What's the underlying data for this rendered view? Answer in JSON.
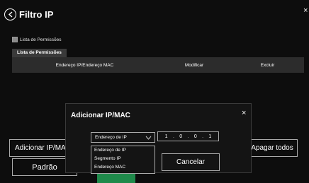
{
  "header": {
    "title": "Filtro IP",
    "close": "×"
  },
  "permissions": {
    "checkbox_label": "Lista de Permissões",
    "tab_label": "Lista de Permissões"
  },
  "table": {
    "columns": [
      "Endereço IP/Endereço MAC",
      "Modificar",
      "Excluir"
    ]
  },
  "buttons": {
    "add": "Adicionar IP/MAC",
    "delete_all": "Apagar todos",
    "default": "Padrão"
  },
  "modal": {
    "title": "Adicionar IP/MAC",
    "close": "×",
    "type_selected": "Endereço de IP",
    "type_options": [
      "Endereço de IP",
      "Segmento IP",
      "Endereço MAC"
    ],
    "ip_octets": [
      "1",
      "0",
      "0",
      "1"
    ],
    "cancel": "Cancelar"
  },
  "colors": {
    "background": "#0d0d0d",
    "accent_green": "#1f8a4b",
    "header_row": "#2c2c2c"
  }
}
